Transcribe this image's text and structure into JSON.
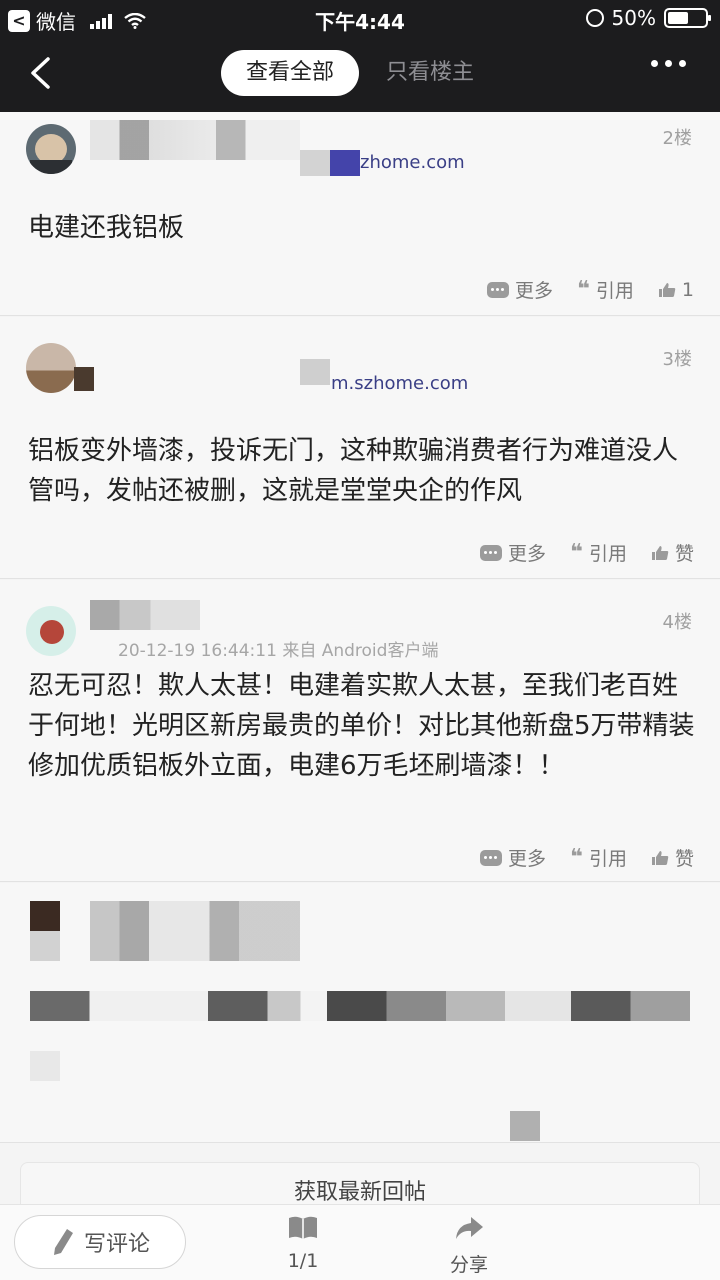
{
  "status_bar": {
    "app_name": "微信",
    "time": "下午4:44",
    "battery": "50%"
  },
  "nav": {
    "tab_all": "查看全部",
    "tab_op": "只看楼主"
  },
  "posts": [
    {
      "floor": "2楼",
      "source": "m.szhome.com",
      "source_partial": "zhome.com",
      "content": "电建还我铝板",
      "actions": {
        "more": "更多",
        "quote": "引用",
        "like": "1"
      }
    },
    {
      "floor": "3楼",
      "source": "m.szhome.com",
      "content": "铝板变外墙漆，投诉无门，这种欺骗消费者行为难道没人管吗，发帖还被删，这就是堂堂央企的作风",
      "actions": {
        "more": "更多",
        "quote": "引用",
        "like": "赞"
      }
    },
    {
      "floor": "4楼",
      "meta": "20-12-19 16:44:11   来自 Android客户端",
      "content": "忍无可忍！欺人太甚！电建着实欺人太甚，至我们老百姓于何地！光明区新房最贵的单价！对比其他新盘5万带精装修加优质铝板外立面，电建6万毛坯刷墙漆！！",
      "actions": {
        "more": "更多",
        "quote": "引用",
        "like": "赞"
      }
    }
  ],
  "refresh_label": "获取最新回帖",
  "bottom": {
    "comment": "写评论",
    "pages": "1/1",
    "share": "分享"
  }
}
